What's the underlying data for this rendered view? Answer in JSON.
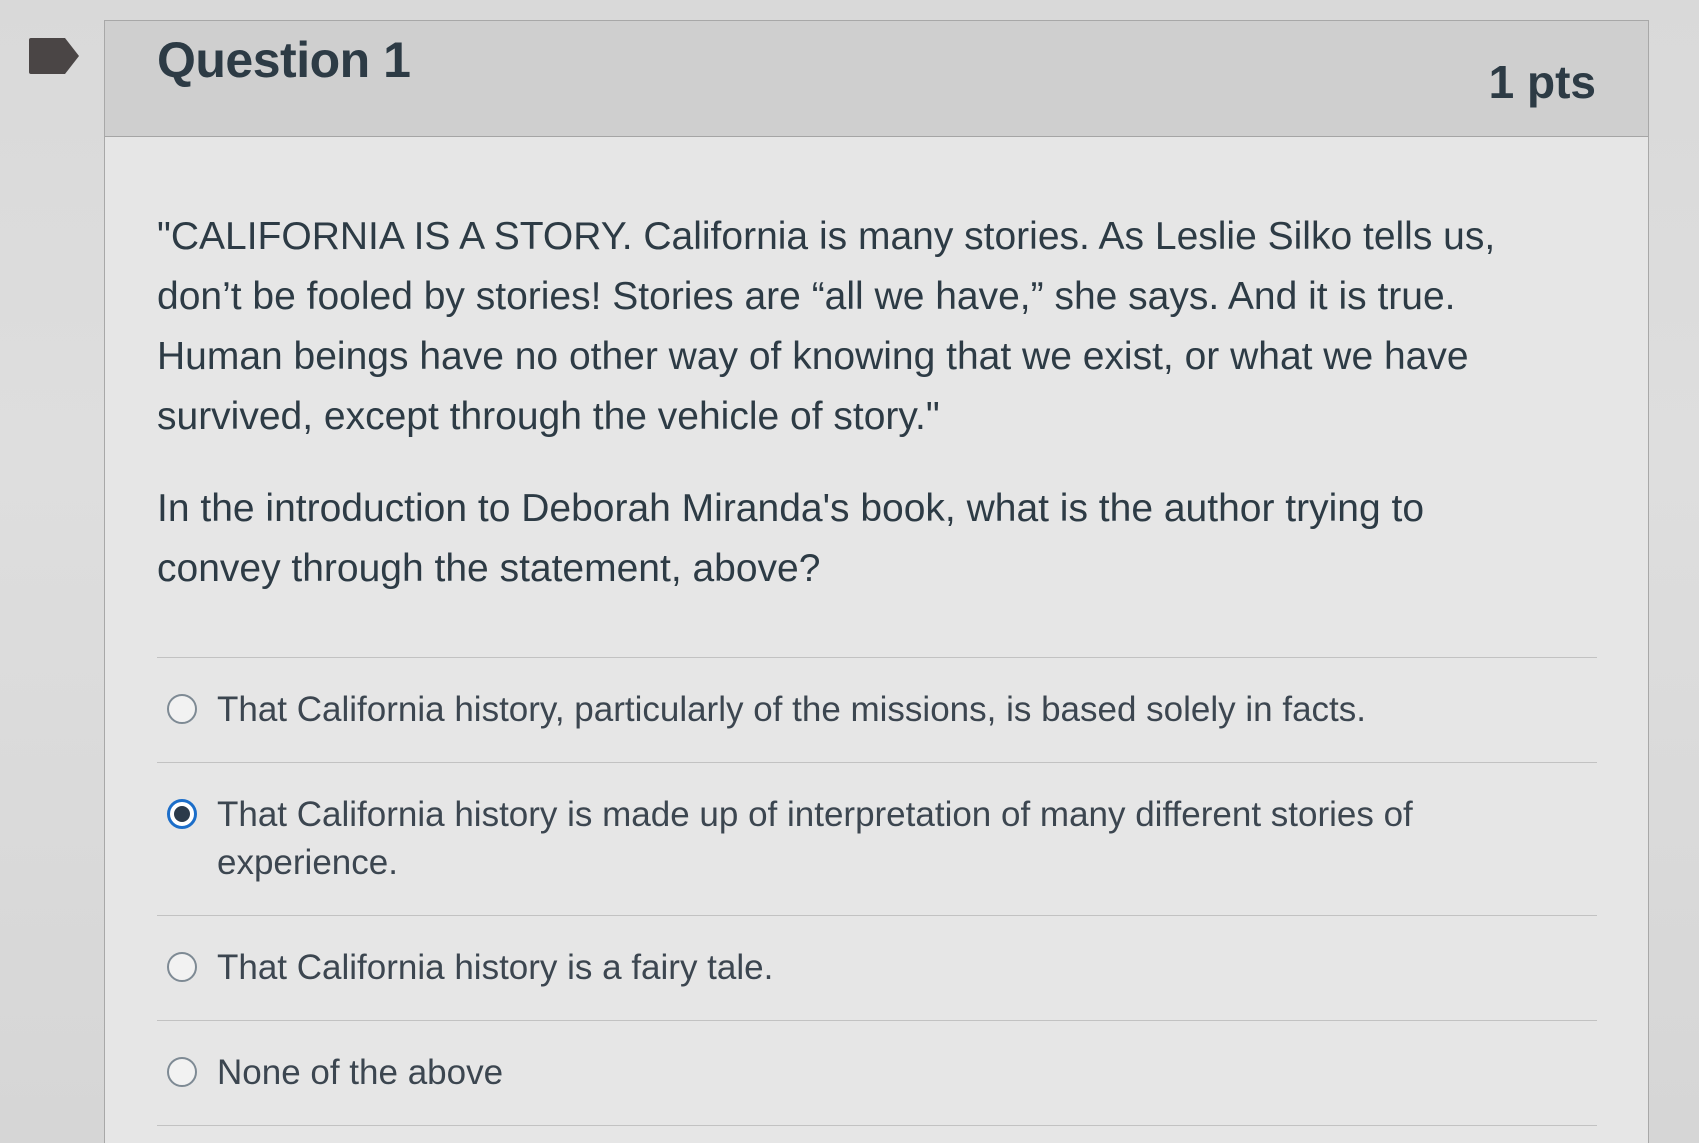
{
  "question": {
    "title": "Question 1",
    "points": "1 pts",
    "passage": "\"CALIFORNIA IS A STORY. California is many stories. As Leslie Silko tells us, don’t be fooled by stories! Stories are “all we have,” she says. And it is true. Human beings have no other way of knowing that we exist, or what we have survived, except through the vehicle of story.\"",
    "prompt": "In the introduction to Deborah Miranda's book, what is the author trying to convey through the statement, above?"
  },
  "answers": [
    {
      "label": "That California history, particularly of the missions, is based solely in facts.",
      "selected": false
    },
    {
      "label": "That California history is made up of interpretation of many different stories of experience.",
      "selected": true
    },
    {
      "label": "That California history is a fairy tale.",
      "selected": false
    },
    {
      "label": "None of the above",
      "selected": false
    }
  ],
  "colors": {
    "flag": "#4a4545",
    "selected_radio": "#1c6ec9",
    "text": "#2d3b45"
  }
}
